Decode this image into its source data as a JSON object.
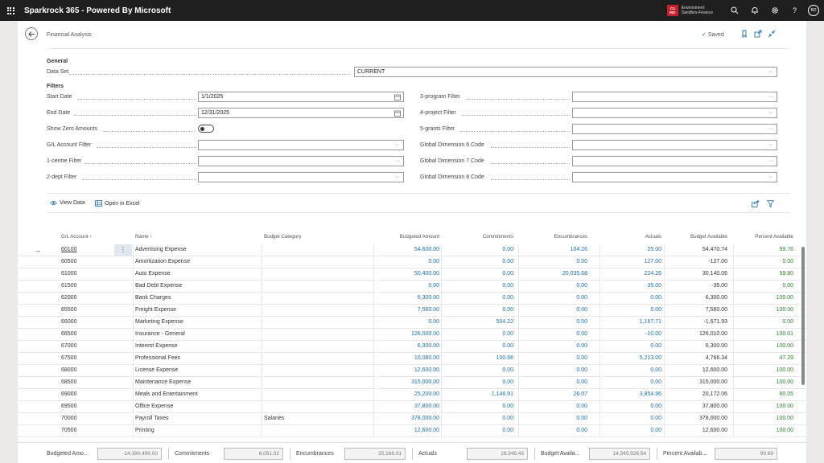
{
  "app": {
    "title": "Sparkrock 365 - Powered By Microsoft",
    "env_badge_line1": "C4",
    "env_badge_line2": "MO",
    "env_label": "Environment:",
    "env_name": "Sandbox-Finance",
    "user_initials": "BD"
  },
  "page": {
    "title": "Financial Analysis",
    "saved_label": "Saved"
  },
  "general": {
    "heading": "General",
    "data_set_label": "Data Set",
    "data_set_value": "CURRENT"
  },
  "filters": {
    "heading": "Filters",
    "start_date_label": "Start Date",
    "start_date_value": "1/1/2025",
    "end_date_label": "End Date",
    "end_date_value": "12/31/2025",
    "show_zero_label": "Show Zero Amounts",
    "gl_account_label": "G/L Account Filter",
    "centre_label": "1-centre Filter",
    "dept_label": "2-dept Filter",
    "program_label": "3-program Filter",
    "project_label": "4-project Filter",
    "grants_label": "5-grants Filter",
    "dim6_label": "Global Dimension 6 Code",
    "dim7_label": "Global Dimension 7 Code",
    "dim8_label": "Global Dimension 8 Code"
  },
  "actions": {
    "view_data": "View Data",
    "open_excel": "Open in Excel"
  },
  "columns": {
    "gl_account": "G/L Account ↑",
    "name": "Name ↑",
    "budget_category": "Budget Category",
    "budgeted_amount": "Budgeted Amount",
    "commitments": "Commitments",
    "encumbrances": "Encumbrances",
    "actuals": "Actuals",
    "budget_available": "Budget Available",
    "percent_available": "Percent Available"
  },
  "rows": [
    {
      "account": "60100",
      "name": "Advertising Expense",
      "category": "",
      "budgeted": "54,600.00",
      "commitments": "0.00",
      "encumbrances": "104.26",
      "actuals": "25.00",
      "available": "54,470.74",
      "percent": "99.76"
    },
    {
      "account": "60500",
      "name": "Amortization Expense",
      "category": "",
      "budgeted": "0.00",
      "commitments": "0.00",
      "encumbrances": "0.00",
      "actuals": "127.00",
      "available": "-127.00",
      "percent": "0.00"
    },
    {
      "account": "61000",
      "name": "Auto Expense",
      "category": "",
      "budgeted": "50,400.00",
      "commitments": "0.00",
      "encumbrances": "20,035.68",
      "actuals": "224.26",
      "available": "30,140.06",
      "percent": "59.80"
    },
    {
      "account": "61500",
      "name": "Bad Debt Expense",
      "category": "",
      "budgeted": "0.00",
      "commitments": "0.00",
      "encumbrances": "0.00",
      "actuals": "35.00",
      "available": "-35.00",
      "percent": "0.00"
    },
    {
      "account": "62000",
      "name": "Bank Charges",
      "category": "",
      "budgeted": "6,300.00",
      "commitments": "0.00",
      "encumbrances": "0.00",
      "actuals": "0.00",
      "available": "6,300.00",
      "percent": "100.00"
    },
    {
      "account": "65500",
      "name": "Freight Expense",
      "category": "",
      "budgeted": "7,560.00",
      "commitments": "0.00",
      "encumbrances": "0.00",
      "actuals": "0.00",
      "available": "7,560.00",
      "percent": "100.00"
    },
    {
      "account": "66000",
      "name": "Marketing Expense",
      "category": "",
      "budgeted": "0.00",
      "commitments": "504.22",
      "encumbrances": "0.00",
      "actuals": "1,167.71",
      "available": "-1,671.93",
      "percent": "0.00"
    },
    {
      "account": "66500",
      "name": "Insurance - General",
      "category": "",
      "budgeted": "126,000.00",
      "commitments": "0.00",
      "encumbrances": "0.00",
      "actuals": "-10.00",
      "available": "126,010.00",
      "percent": "100.01"
    },
    {
      "account": "67000",
      "name": "Interest Expense",
      "category": "",
      "budgeted": "6,300.00",
      "commitments": "0.00",
      "encumbrances": "0.00",
      "actuals": "0.00",
      "available": "6,300.00",
      "percent": "100.00"
    },
    {
      "account": "67500",
      "name": "Professional Fees",
      "category": "",
      "budgeted": "10,080.00",
      "commitments": "100.66",
      "encumbrances": "0.00",
      "actuals": "5,213.00",
      "available": "4,766.34",
      "percent": "47.29"
    },
    {
      "account": "68000",
      "name": "License Expense",
      "category": "",
      "budgeted": "12,600.00",
      "commitments": "0.00",
      "encumbrances": "0.00",
      "actuals": "0.00",
      "available": "12,600.00",
      "percent": "100.00"
    },
    {
      "account": "68500",
      "name": "Maintenance Expense",
      "category": "",
      "budgeted": "315,000.00",
      "commitments": "0.00",
      "encumbrances": "0.00",
      "actuals": "0.00",
      "available": "315,000.00",
      "percent": "100.00"
    },
    {
      "account": "69000",
      "name": "Meals and Entertainment",
      "category": "",
      "budgeted": "25,200.00",
      "commitments": "1,146.91",
      "encumbrances": "26.07",
      "actuals": "3,854.96",
      "available": "20,172.06",
      "percent": "80.05"
    },
    {
      "account": "69500",
      "name": "Office Expense",
      "category": "",
      "budgeted": "37,800.00",
      "commitments": "0.00",
      "encumbrances": "0.00",
      "actuals": "0.00",
      "available": "37,800.00",
      "percent": "100.00"
    },
    {
      "account": "70000",
      "name": "Payroll Taxes",
      "category": "Salaries",
      "budgeted": "378,000.00",
      "commitments": "0.00",
      "encumbrances": "0.00",
      "actuals": "0.00",
      "available": "378,000.00",
      "percent": "100.00"
    },
    {
      "account": "70500",
      "name": "Printing",
      "category": "",
      "budgeted": "12,600.00",
      "commitments": "0.00",
      "encumbrances": "0.00",
      "actuals": "0.00",
      "available": "12,600.00",
      "percent": "100.00"
    }
  ],
  "totals": {
    "budgeted_label": "Budgeted Amo...",
    "budgeted_value": "14,390,490.00",
    "commitments_label": "Commitments",
    "commitments_value": "6,051.02",
    "encumbrances_label": "Encumbrances",
    "encumbrances_value": "20,166.01",
    "actuals_label": "Actuals",
    "actuals_value": "18,346.43",
    "available_label": "Budget Availa...",
    "available_value": "14,345,926.54",
    "percent_label": "Percent Availab...",
    "percent_value": "99.69"
  },
  "colors": {
    "topbar": "#1f1f1f",
    "badge": "#c8202b",
    "link_blue": "#1a6ea8",
    "green": "#2e7d32"
  }
}
